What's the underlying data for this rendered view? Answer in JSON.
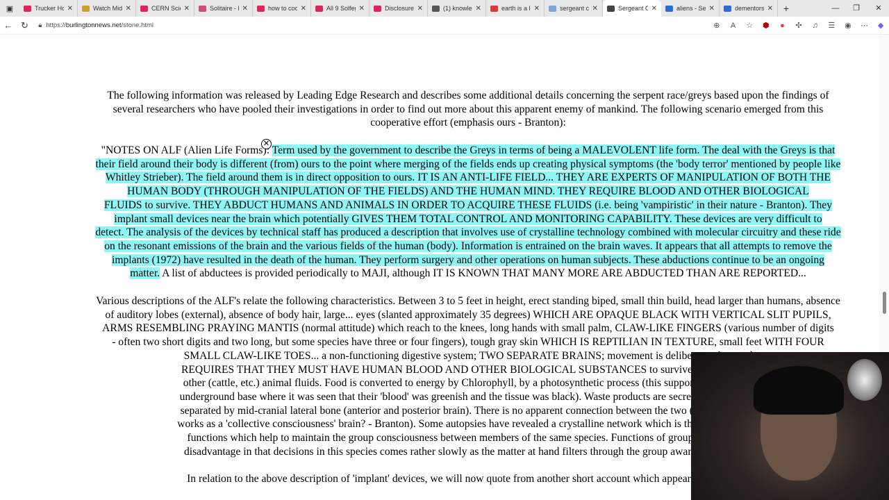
{
  "browser": {
    "tabs": [
      {
        "label": "Trucker Hom",
        "color": "#e0245e"
      },
      {
        "label": "Watch Midn",
        "color": "#c9a227"
      },
      {
        "label": "CERN Scient",
        "color": "#e0245e"
      },
      {
        "label": "Solitaire - Pl",
        "color": "#d04a7a"
      },
      {
        "label": "how to cook",
        "color": "#e0245e"
      },
      {
        "label": "All 9 Solfegg",
        "color": "#e0245e"
      },
      {
        "label": "Disclosure S",
        "color": "#e0245e"
      },
      {
        "label": "(1) knowled",
        "color": "#555555"
      },
      {
        "label": "earth is a lo",
        "color": "#d83a3a"
      },
      {
        "label": "sergeant clif",
        "color": "#7aa7d8"
      },
      {
        "label": "Sergeant Cl",
        "color": "#444444",
        "active": true
      },
      {
        "label": "aliens - Sear",
        "color": "#2a6dd6"
      },
      {
        "label": "dementors",
        "color": "#2a6dd6"
      }
    ],
    "url_prefix": "https://",
    "url_domain": "burlingtonnews.net",
    "url_path": "/stone.html"
  },
  "page": {
    "paragraphs": [
      [
        [
          [
            "The following information was released by Leading Edge Research and describes some additional details concerning the serpent race/greys based upon the findings of",
            false
          ]
        ],
        [
          [
            "several researchers who have pooled their investigations in order to find out more about this apparent enemy of mankind. The following scenario emerged from this",
            false
          ]
        ],
        [
          [
            "cooperative effort (emphasis ours - Branton):",
            false
          ]
        ]
      ],
      [
        [
          [
            "\"NOTES ON ALF (Alien Life Forms): ",
            false
          ],
          [
            "Term used by the government to describe the Greys in terms of being a MALEVOLENT life form. The deal with the Greys is that",
            true
          ]
        ],
        [
          [
            "their field around their body is different (from) ours to the point where merging of the fields ends up creating physical symptoms (the 'body terror' mentioned by people like",
            true
          ]
        ],
        [
          [
            "Whitley Strieber). The field around them is in direct opposition to ours. IT IS AN ANTI-LIFE FIELD... THEY ARE EXPERTS OF MANIPULATION OF BOTH THE",
            true
          ]
        ],
        [
          [
            "HUMAN BODY (THROUGH MANIPULATION OF THE FIELDS) AND THE HUMAN MIND. THEY REQUIRE BLOOD AND OTHER BIOLOGICAL",
            true
          ]
        ],
        [
          [
            "FLUIDS to survive. THEY ABDUCT HUMANS AND ANIMALS IN ORDER TO ACQUIRE THESE FLUIDS (i.e. being 'vampiristic' in their nature - Branton). They",
            true
          ]
        ],
        [
          [
            "implant small devices near the brain which potentially GIVES THEM TOTAL CONTROL AND MONITORING CAPABILITY. These devices are very difficult to",
            true
          ]
        ],
        [
          [
            "detect. The analysis of the devices by technical staff has produced a description that involves use of crystalline technology combined with molecular circuitry and these ride",
            true
          ]
        ],
        [
          [
            "on the resonant emissions of the brain and the various fields of the human (body). Information is entrained on the brain waves. It appears that all attempts to remove the",
            true
          ]
        ],
        [
          [
            "implants (1972) have resulted in the death of the human. They perform surgery and other operations on human subjects. These abductions continue to be an ongoing",
            true
          ]
        ],
        [
          [
            "matter.",
            true
          ],
          [
            " A list of abductees is provided periodically to MAJI, although IT IS KNOWN THAT MANY MORE ARE ABDUCTED THAN ARE REPORTED...",
            false
          ]
        ]
      ],
      [
        [
          [
            "Various descriptions of the ALF's relate the following characteristics. Between 3 to 5 feet in height, erect standing biped, small thin build, head larger than humans, absence",
            false
          ]
        ],
        [
          [
            "of auditory lobes (external), absence of body hair, large... eyes (slanted approximately 35 degrees) WHICH ARE OPAQUE BLACK WITH VERTICAL SLIT PUPILS,",
            false
          ]
        ],
        [
          [
            "ARMS RESEMBLING PRAYING MANTIS (normal attitude) which reach to the knees, long hands with small palm, CLAW-LIKE FINGERS (various number of digits",
            false
          ]
        ],
        [
          [
            "- often two short digits and two long, but some species have three or four fingers), tough gray skin WHICH IS REPTILIAN IN TEXTURE, small feet WITH FOUR",
            false
          ]
        ],
        [
          [
            "SMALL CLAW-LIKE TOES... a non-functioning digestive system; TWO SEPARATE BRAINS; movement is deliberate, slow and",
            false
          ]
        ],
        [
          [
            "REQUIRES THAT THEY MUST HAVE HUMAN BLOOD AND OTHER BIOLOGICAL SUBSTANCES to survive. In extreme ci",
            false
          ]
        ],
        [
          [
            "other (cattle, etc.) animal fluids. Food is converted to energy by Chlorophyll, by a photosynthetic process (this supports results gain",
            false
          ]
        ],
        [
          [
            "underground base where it was seen that their 'blood' was greenish and the tissue was black). Waste products are secreted through the",
            false
          ]
        ],
        [
          [
            "separated by mid-cranial lateral bone (anterior and posterior brain). There is no apparent connection between the two (could one be a",
            false
          ]
        ],
        [
          [
            "works as a 'collective consciousness' brain? - Branton). Some autopsies have revealed a crystalline network which is thought to have a",
            false
          ]
        ],
        [
          [
            "functions which help to maintain the group consciousness between members of the same species. Functions of group consciousne",
            false
          ]
        ],
        [
          [
            "disadvantage in that decisions in this species comes rather slowly as the matter at hand filters through the group awareness of those",
            false
          ]
        ]
      ],
      [
        [
          [
            "In relation to the above description of 'implant' devices, we will now quote from another short account which appeared in the N.A",
            false
          ]
        ]
      ]
    ],
    "highlight_color": "#8ef6f6"
  }
}
